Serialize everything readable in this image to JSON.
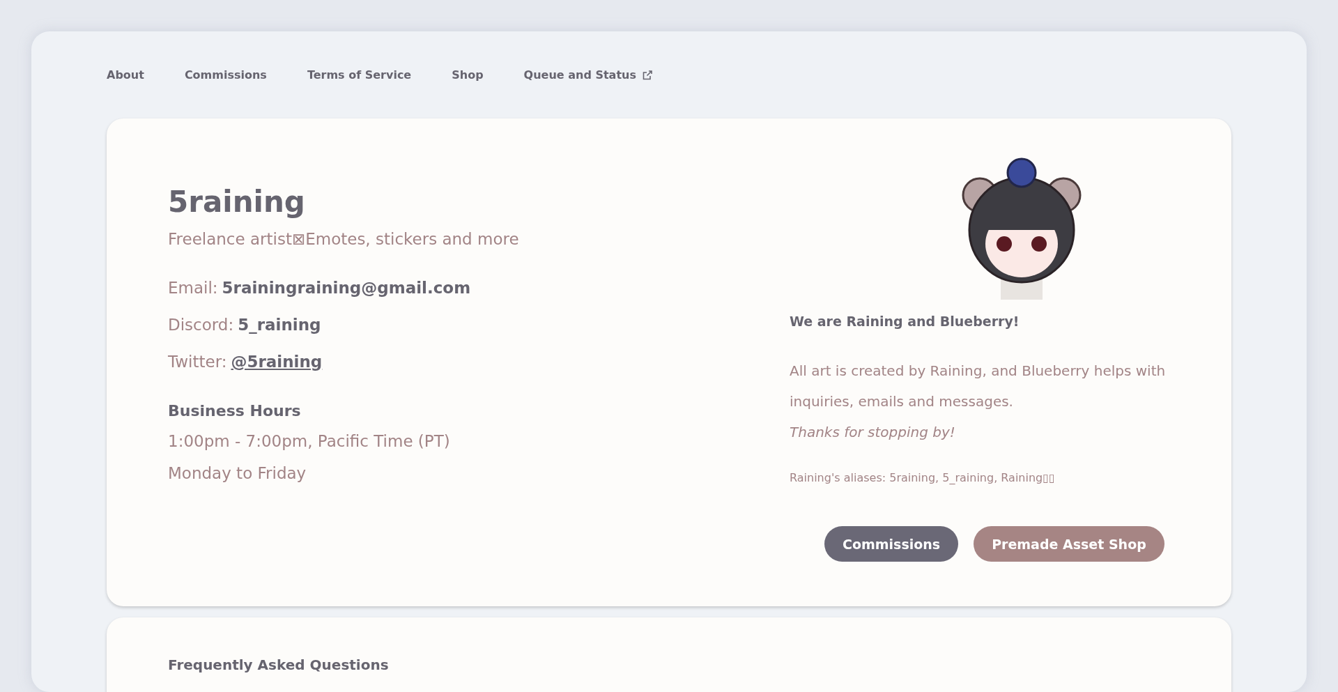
{
  "nav": [
    {
      "label": "About",
      "external": false
    },
    {
      "label": "Commissions",
      "external": false
    },
    {
      "label": "Terms of Service",
      "external": false
    },
    {
      "label": "Shop",
      "external": false
    },
    {
      "label": "Queue and Status",
      "external": true
    }
  ],
  "profile": {
    "name": "5raining",
    "tagline": "Freelance artist⊠Emotes, stickers and more",
    "contacts": [
      {
        "label": "Email:",
        "value": "5rainingraining@gmail.com",
        "kind": "text"
      },
      {
        "label": "Discord:",
        "value": "5_raining",
        "kind": "text"
      },
      {
        "label": "Twitter:",
        "value": "@5raining",
        "kind": "link"
      }
    ],
    "hours_title": "Business Hours",
    "hours": [
      "1:00pm - 7:00pm, Pacific Time (PT)",
      "Monday to Friday"
    ],
    "intro_title": "We are Raining and Blueberry!",
    "intro": "All art is created by Raining, and Blueberry helps with inquiries, emails and messages.",
    "thanks": "Thanks for stopping by!",
    "aliases": "Raining's aliases: 5raining, 5_raining, Raining▯▯",
    "buttons": [
      {
        "label": "Commissions",
        "kind": "primary"
      },
      {
        "label": "Premade Asset Shop",
        "kind": "secondary"
      }
    ]
  },
  "faq": {
    "title": "Frequently Asked Questions"
  }
}
